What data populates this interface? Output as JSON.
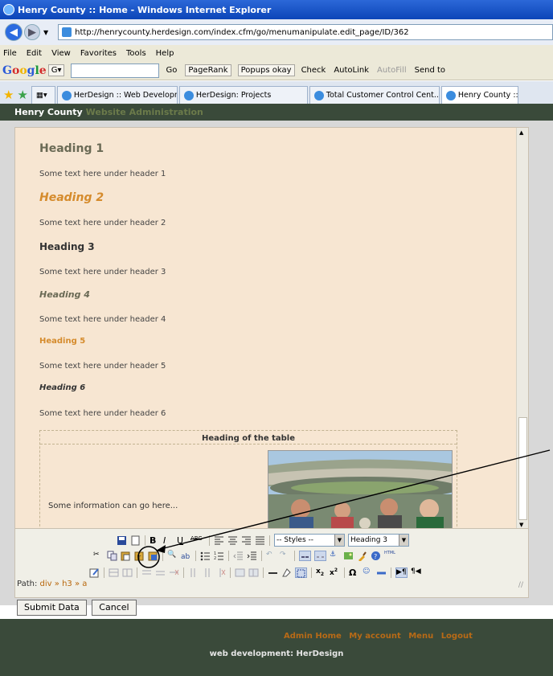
{
  "browser": {
    "title": "Henry County :: Home - Windows Internet Explorer",
    "url": "http://henrycounty.herdesign.com/index.cfm/go/menumanipulate.edit_page/ID/362",
    "menu": [
      "File",
      "Edit",
      "View",
      "Favorites",
      "Tools",
      "Help"
    ],
    "google_toolbar": {
      "logo": "Google",
      "go": "Go",
      "pagerank": "PageRank",
      "popups": "Popups okay",
      "check": "Check",
      "autolink": "AutoLink",
      "autofill": "AutoFill",
      "sendto": "Send to"
    },
    "tabs": [
      "HerDesign :: Web Developm...",
      "HerDesign: Projects",
      "Total Customer Control Cent...",
      "Henry County ::"
    ]
  },
  "app": {
    "title": "Henry County",
    "subtitle": "Website Administration"
  },
  "editor": {
    "headings": {
      "h1": "Heading 1",
      "h2": "Heading 2",
      "h3": "Heading 3",
      "h4": "Heading 4",
      "h5": "Heading 5",
      "h6": "Heading 6"
    },
    "paragraphs": {
      "p1": "Some text here under header 1",
      "p2": "Some text here under header 2",
      "p3": "Some text here under header 3",
      "p4": "Some text here under header 4",
      "p5": "Some text here under header 5",
      "p6": "Some text here under header 6"
    },
    "table": {
      "heading": "Heading of the table",
      "cell_text": "Some information can go here..."
    },
    "toolbar": {
      "styles_select": "-- Styles --",
      "format_select": "Heading 3"
    },
    "path": {
      "label": "Path:",
      "items": [
        "div",
        "h3",
        "a"
      ],
      "sep": "»"
    }
  },
  "form": {
    "submit_label": "Submit Data",
    "cancel_label": "Cancel"
  },
  "footer": {
    "links": [
      "Admin Home",
      "My account",
      "Menu",
      "Logout"
    ],
    "credit": "web development: HerDesign"
  },
  "colors": {
    "editor_bg": "#f7e6d2",
    "footer_bg": "#3a4a3a",
    "accent_orange": "#d58b2c",
    "link_orange": "#b86a16"
  }
}
